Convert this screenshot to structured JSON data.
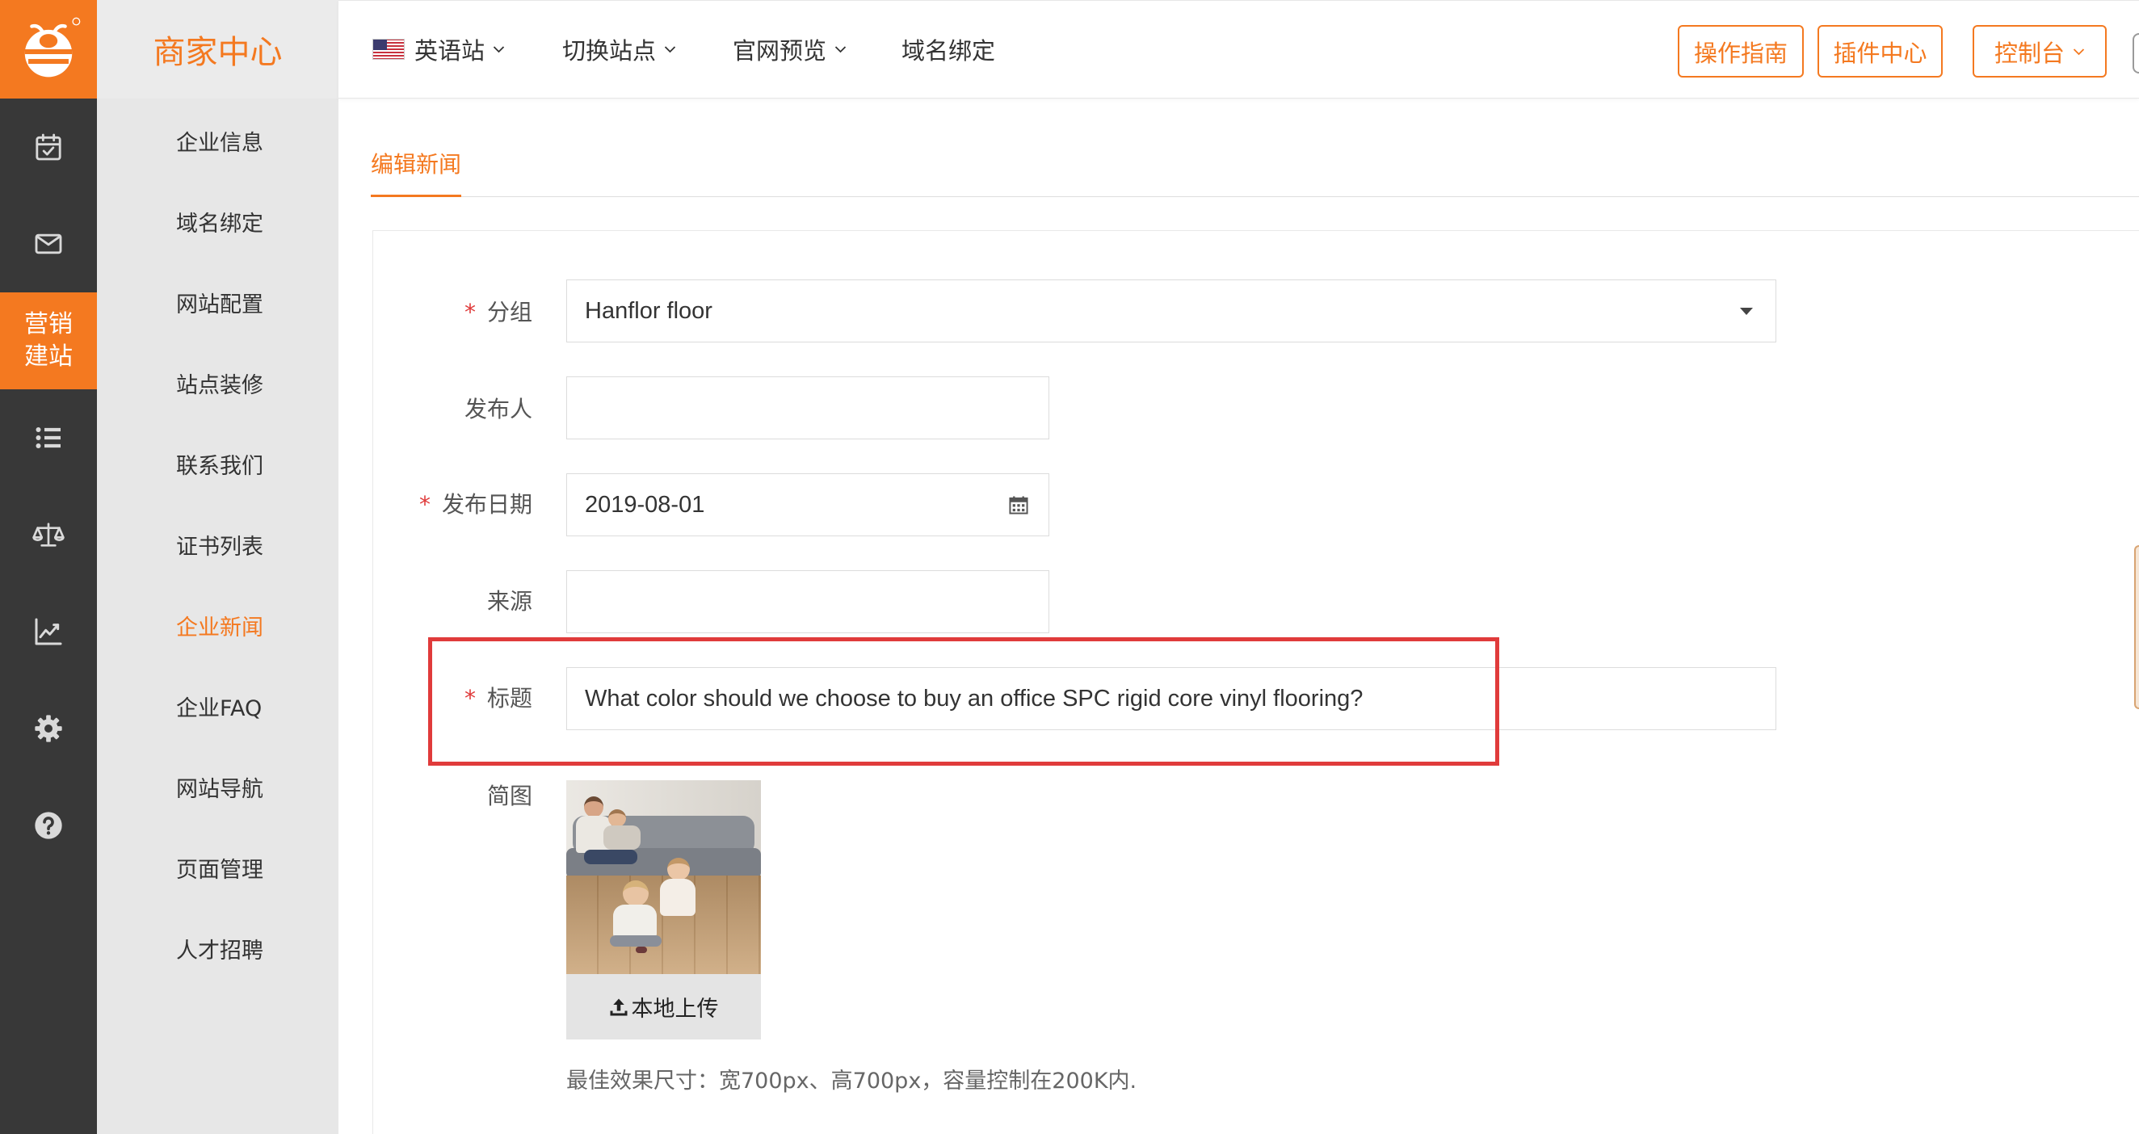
{
  "app": {
    "brand_title": "商家中心"
  },
  "rail": {
    "items": [
      {
        "icon": "calendar-check-icon"
      },
      {
        "icon": "mail-icon"
      },
      {
        "label_line1": "营销",
        "label_line2": "建站",
        "active": true
      },
      {
        "icon": "list-icon"
      },
      {
        "icon": "scale-icon"
      },
      {
        "icon": "chart-line-icon"
      },
      {
        "icon": "gear-icon"
      },
      {
        "icon": "help-circle-icon"
      }
    ]
  },
  "sidebar": {
    "items": [
      {
        "label": "企业信息"
      },
      {
        "label": "域名绑定"
      },
      {
        "label": "网站配置"
      },
      {
        "label": "站点装修"
      },
      {
        "label": "联系我们"
      },
      {
        "label": "证书列表"
      },
      {
        "label": "企业新闻",
        "active": true
      },
      {
        "label": "企业FAQ"
      },
      {
        "label": "网站导航"
      },
      {
        "label": "页面管理"
      },
      {
        "label": "人才招聘"
      }
    ]
  },
  "topbar": {
    "site": {
      "flag_icon": "us-flag-icon",
      "label": "英语站"
    },
    "switch_site_label": "切换站点",
    "preview_label": "官网预览",
    "domain_bind_label": "域名绑定",
    "guide_button": "操作指南",
    "plugins_button": "插件中心",
    "console_button": "控制台"
  },
  "page": {
    "tab_label": "编辑新闻"
  },
  "form": {
    "group": {
      "required_mark": "*",
      "label": "分组",
      "value": "Hanflor floor"
    },
    "author": {
      "label": "发布人",
      "value": ""
    },
    "date": {
      "required_mark": "*",
      "label": "发布日期",
      "value": "2019-08-01"
    },
    "source": {
      "label": "来源",
      "value": ""
    },
    "title": {
      "required_mark": "*",
      "label": "标题",
      "value": "What color should we choose to buy an office SPC rigid core vinyl flooring?"
    },
    "thumbnail": {
      "label": "简图",
      "upload_button": "本地上传",
      "hint": "最佳效果尺寸：宽700px、高700px，容量控制在200K内."
    }
  },
  "colors": {
    "accent": "#f47920",
    "highlight_border": "#e03b3b",
    "rail_background": "#383838",
    "sidebar_background": "#e7e7e7"
  }
}
